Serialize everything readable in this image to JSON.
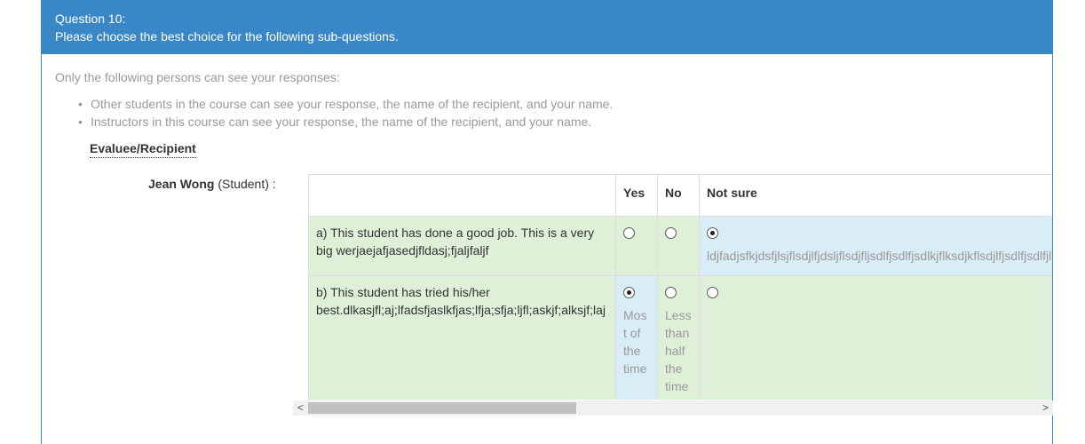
{
  "question": {
    "number_label": "Question 10:",
    "instruction": "Please choose the best choice for the following sub-questions."
  },
  "visibility": {
    "intro": "Only the following persons can see your responses:",
    "items": [
      "Other students in the course can see your response, the name of the recipient, and your name.",
      "Instructors in this course can see your response, the name of the recipient, and your name."
    ]
  },
  "recipient_label": "Evaluee/Recipient",
  "evaluee": {
    "name": "Jean Wong",
    "role": "(Student) :"
  },
  "columns": [
    "Yes",
    "No",
    "Not sure"
  ],
  "rows": [
    {
      "question": "a) This student has done a good job. This is a very big werjaejafjasedjfldasj;fjaljfaljf",
      "selected_index": 2,
      "descriptions": [
        "",
        "",
        "ldjfadjsfkjdsfjlsjflsdjlfjdsljflsdjfljsdlfjsdlfjsdlkjflksdjkflsdjlfjsdlfjsdlfjlskdj"
      ]
    },
    {
      "question": "b) This student has tried his/her best.dlkasjfl;aj;lfadsfjaslkfjas;lfja;sfja;ljfl;askjf;alksjf;laj",
      "selected_index": 0,
      "descriptions": [
        "Most of the time",
        "Less than half the time",
        ""
      ]
    }
  ],
  "scrollbar": {
    "left_arrow": "<",
    "right_arrow": ">"
  },
  "colors": {
    "heading_bg": "#3a87c8",
    "row_bg": "#dff0d8",
    "selected_bg": "#d9edf7"
  }
}
